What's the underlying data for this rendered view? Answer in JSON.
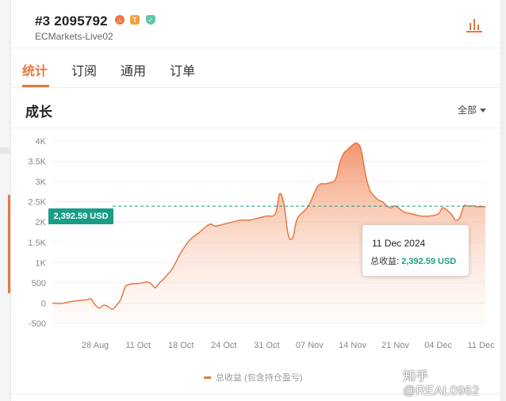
{
  "header": {
    "rank": "#3",
    "account_id": "2095792",
    "server": "ECMarkets-Live02",
    "badges": [
      {
        "name": "fire-badge-icon",
        "glyph": "♨",
        "color": "#e8773f"
      },
      {
        "name": "t-badge-icon",
        "glyph": "T",
        "color": "#f0a040"
      },
      {
        "name": "verified-shield-icon",
        "glyph": "✓",
        "color": "#5cc7a8"
      }
    ]
  },
  "tabs": [
    {
      "label": "统计",
      "active": true
    },
    {
      "label": "订阅",
      "active": false
    },
    {
      "label": "通用",
      "active": false
    },
    {
      "label": "订单",
      "active": false
    }
  ],
  "section": {
    "title": "成长",
    "range_label": "全部"
  },
  "tooltip": {
    "date": "11 Dec 2024",
    "label": "总收益:",
    "value": "2,392.59 USD"
  },
  "current_value_tag": "2,392.59 USD",
  "legend_label": "总收益 (包含持仓盈亏)",
  "watermark": "知乎 @REAL0962",
  "colors": {
    "accent": "#e8773f",
    "green": "#1a9c86"
  },
  "chart_data": {
    "type": "area",
    "title": "",
    "xlabel": "",
    "ylabel": "",
    "ylim": [
      -500,
      4000
    ],
    "yticks": [
      -500,
      0,
      500,
      1000,
      1500,
      2000,
      2500,
      3000,
      3500,
      4000
    ],
    "ytick_labels": [
      "-500",
      "0",
      "500",
      "1K",
      "1.5K",
      "2K",
      "2.5K",
      "3K",
      "3.5K",
      "4K"
    ],
    "xticks": [
      {
        "label": "28 Aug",
        "pos": 10
      },
      {
        "label": "11 Oct",
        "pos": 20
      },
      {
        "label": "18 Oct",
        "pos": 30
      },
      {
        "label": "24 Oct",
        "pos": 40
      },
      {
        "label": "31 Oct",
        "pos": 50
      },
      {
        "label": "07 Nov",
        "pos": 60
      },
      {
        "label": "14 Nov",
        "pos": 70
      },
      {
        "label": "21 Nov",
        "pos": 80
      },
      {
        "label": "04 Dec",
        "pos": 90
      },
      {
        "label": "11 Dec",
        "pos": 100
      }
    ],
    "xlim": [
      0,
      101
    ],
    "reference_line": 2392.59,
    "series": [
      {
        "name": "总收益 (包含持仓盈亏)",
        "x": [
          0,
          2,
          4,
          6,
          8,
          9,
          10,
          11,
          12,
          13,
          14,
          15,
          16,
          17,
          18,
          19,
          20,
          21,
          22,
          23,
          24,
          25,
          26,
          27,
          28,
          29,
          30,
          32,
          34,
          36,
          37,
          38,
          40,
          42,
          44,
          46,
          48,
          50,
          52,
          53,
          54,
          55,
          56,
          57,
          58,
          59,
          60,
          62,
          64,
          66,
          67,
          68,
          69,
          70,
          71,
          72,
          73,
          74,
          75,
          76,
          77,
          78,
          79,
          80,
          82,
          84,
          86,
          88,
          90,
          91,
          92,
          93,
          94,
          95,
          96,
          97,
          98,
          99,
          100,
          101
        ],
        "values": [
          0,
          -10,
          30,
          60,
          80,
          100,
          -50,
          -120,
          -50,
          -90,
          -150,
          -50,
          100,
          400,
          460,
          480,
          480,
          500,
          520,
          480,
          380,
          500,
          600,
          720,
          850,
          1050,
          1250,
          1550,
          1720,
          1900,
          1950,
          1900,
          1950,
          2000,
          2050,
          2050,
          2100,
          2150,
          2200,
          2700,
          2450,
          1700,
          1600,
          2050,
          2200,
          2300,
          2450,
          2900,
          2950,
          3050,
          3450,
          3700,
          3800,
          3900,
          3950,
          3800,
          3200,
          2800,
          2650,
          2550,
          2500,
          2400,
          2350,
          2400,
          2250,
          2200,
          2150,
          2150,
          2200,
          2350,
          2300,
          2200,
          2050,
          2100,
          2400,
          2392,
          2400,
          2380,
          2380,
          2380
        ]
      }
    ]
  }
}
